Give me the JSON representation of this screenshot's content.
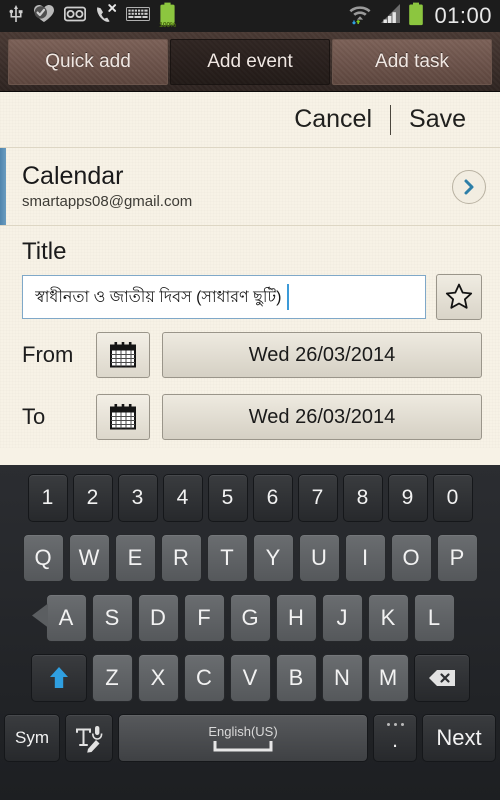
{
  "status_bar": {
    "icons": [
      "usb-icon",
      "heart-check-icon",
      "voicemail-icon",
      "missed-call-icon",
      "keyboard-icon",
      "battery-icon"
    ],
    "battery_percent": "100%",
    "right_icons": [
      "wifi-icon",
      "signal-icon",
      "battery-icon"
    ],
    "clock": "01:00"
  },
  "tabs": [
    {
      "label": "Quick add",
      "selected": false
    },
    {
      "label": "Add event",
      "selected": true
    },
    {
      "label": "Add task",
      "selected": false
    }
  ],
  "action_bar": {
    "cancel_label": "Cancel",
    "save_label": "Save"
  },
  "calendar": {
    "title": "Calendar",
    "account": "smartapps08@gmail.com",
    "accent_color": "#4f84ad"
  },
  "title_field": {
    "label": "Title",
    "value": "স্বাধীনতা ও জাতীয় দিবস (সাধারণ ছুটি)",
    "placeholder": "Title",
    "focus_color": "#7fa8c8"
  },
  "dates": {
    "from_label": "From",
    "from_value": "Wed 26/03/2014",
    "to_label": "To",
    "to_value": "Wed 26/03/2014"
  },
  "keyboard": {
    "row_numbers": [
      "1",
      "2",
      "3",
      "4",
      "5",
      "6",
      "7",
      "8",
      "9",
      "0"
    ],
    "row_top": [
      "Q",
      "W",
      "E",
      "R",
      "T",
      "Y",
      "U",
      "I",
      "O",
      "P"
    ],
    "row_home": [
      "A",
      "S",
      "D",
      "F",
      "G",
      "H",
      "J",
      "K",
      "L"
    ],
    "row_bottom": [
      "Z",
      "X",
      "C",
      "V",
      "B",
      "N",
      "M"
    ],
    "shift_label": "",
    "backspace_label": "",
    "sym_label": "Sym",
    "handwriting_label": "",
    "space_label": "English(US)",
    "period_label": ".",
    "next_label": "Next",
    "shift_color": "#2f9fe0"
  }
}
